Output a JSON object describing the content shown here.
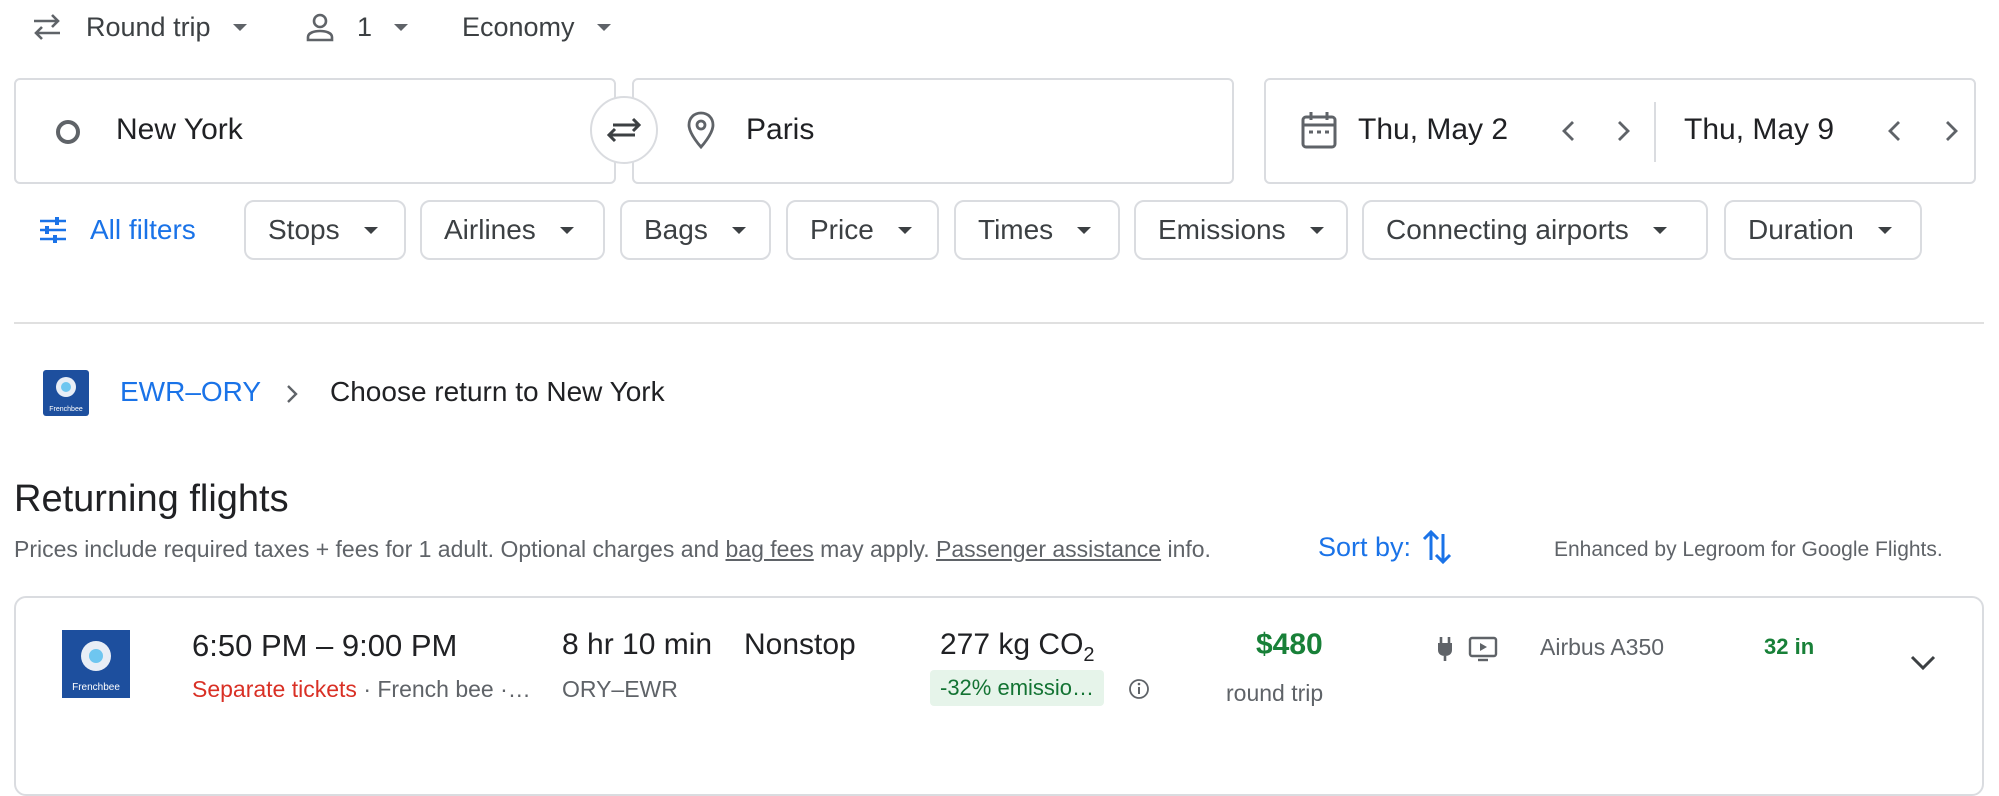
{
  "top_bar": {
    "trip_type": "Round trip",
    "passengers": "1",
    "cabin_class": "Economy"
  },
  "search": {
    "origin": "New York",
    "destination": "Paris",
    "depart_date": "Thu, May 2",
    "return_date": "Thu, May 9"
  },
  "filters": {
    "all_filters": "All filters",
    "chips": [
      "Stops",
      "Airlines",
      "Bags",
      "Price",
      "Times",
      "Emissions",
      "Connecting airports",
      "Duration"
    ]
  },
  "breadcrumb": {
    "route": "EWR–ORY",
    "current": "Choose return to New York"
  },
  "results": {
    "heading": "Returning flights",
    "disclaimer_prefix": "Prices include required taxes + fees for 1 adult. Optional charges and ",
    "bag_fees_link": "bag fees",
    "disclaimer_middle": " may apply. ",
    "assistance_link": "Passenger assistance",
    "disclaimer_suffix": " info.",
    "sort_label": "Sort by:",
    "legroom_note": "Enhanced by Legroom for Google Flights."
  },
  "flight": {
    "airline_logo_text": "Frenchbee",
    "times": "6:50 PM – 9:00 PM",
    "separate_tickets": "Separate tickets",
    "airline_line": "· French bee ·…",
    "duration": "8 hr 10 min",
    "route": "ORY–EWR",
    "stops": "Nonstop",
    "emissions_value": "277 kg CO",
    "emissions_sub": "2",
    "emissions_badge": "-32% emissio…",
    "price": "$480",
    "price_note": "round trip",
    "aircraft": "Airbus A350",
    "legroom": "32 in"
  },
  "colors": {
    "accent_blue": "#1a73e8",
    "price_green": "#188038",
    "warning_red": "#d93025",
    "badge_bg": "#e6f4ea",
    "logo_blue": "#1d4f9e"
  }
}
